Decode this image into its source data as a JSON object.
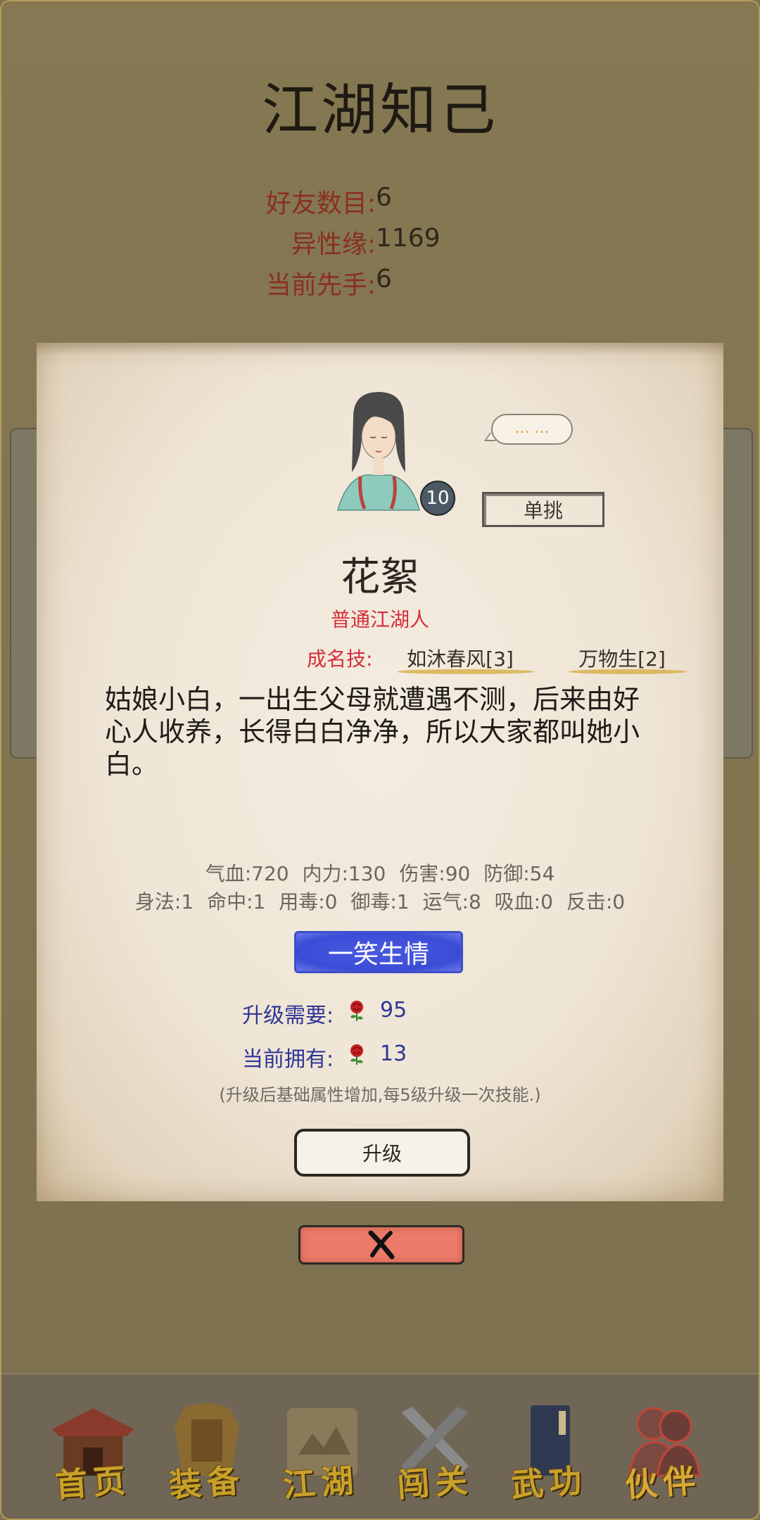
{
  "header": {
    "title": "江湖知己"
  },
  "stats": [
    {
      "label": "好友数目:",
      "value": "6"
    },
    {
      "label": "异性缘:",
      "value": "1169"
    },
    {
      "label": "当前先手:",
      "value": "6"
    }
  ],
  "character": {
    "level": "10",
    "speech": "... ...",
    "duel_label": "单挑",
    "name": "花絮",
    "type": "普通江湖人",
    "skills_label": "成名技:",
    "skills": [
      "如沐春风[3]",
      "万物生[2]"
    ],
    "bio": "姑娘小白，一出生父母就遭遇不测，后来由好心人收养，长得白白净净，所以大家都叫她小白。",
    "attributes_line1": "气血:720 内力:130 伤害:90 防御:54",
    "attributes_line2": "身法:1 命中:1 用毒:0 御毒:1 运气:8 吸血:0 反击:0",
    "special_skill": "一笑生情"
  },
  "upgrade": {
    "need_label": "升级需要:",
    "need_value": "95",
    "have_label": "当前拥有:",
    "have_value": "13",
    "hint": "(升级后基础属性增加,每5级升级一次技能.)",
    "button_label": "升级"
  },
  "nav": {
    "items": [
      {
        "label": "首页",
        "icon": "house-icon"
      },
      {
        "label": "装备",
        "icon": "armor-icon"
      },
      {
        "label": "江湖",
        "icon": "scroll-map-icon"
      },
      {
        "label": "闯关",
        "icon": "crossed-swords-icon"
      },
      {
        "label": "武功",
        "icon": "book-icon"
      },
      {
        "label": "伙伴",
        "icon": "companions-icon"
      }
    ]
  },
  "colors": {
    "background": "#7f7250",
    "paper": "#efe5d6",
    "label_red": "#8a2f22",
    "skill_red": "#d62d3c",
    "cost_blue": "#2f3596",
    "skill_button_blue": "#3b4cd6",
    "close_button": "#ec7a68",
    "nav_gold": "#c9a02a"
  }
}
